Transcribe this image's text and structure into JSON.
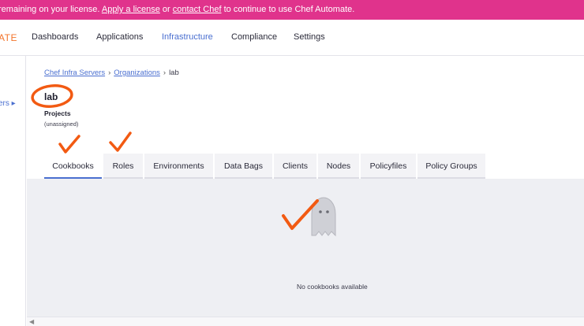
{
  "banner": {
    "text_before": " remaining on your license. ",
    "apply_link": "Apply a license",
    "text_or": " or ",
    "contact_link": "contact Chef",
    "text_after": " to continue to use Chef Automate."
  },
  "topnav": {
    "logo": "ATE",
    "items": [
      {
        "label": "Dashboards"
      },
      {
        "label": "Applications"
      },
      {
        "label": "Infrastructure"
      },
      {
        "label": "Compliance"
      },
      {
        "label": "Settings"
      }
    ],
    "active": "Infrastructure"
  },
  "sidebar": {
    "item_label": "ers ▸"
  },
  "breadcrumb": {
    "items": [
      "Chef Infra Servers",
      "Organizations",
      "lab"
    ],
    "separator": "›"
  },
  "page": {
    "title": "lab",
    "projects_label": "Projects",
    "projects_value": "(unassigned)"
  },
  "tabs": [
    {
      "label": "Cookbooks"
    },
    {
      "label": "Roles"
    },
    {
      "label": "Environments"
    },
    {
      "label": "Data Bags"
    },
    {
      "label": "Clients"
    },
    {
      "label": "Nodes"
    },
    {
      "label": "Policyfiles"
    },
    {
      "label": "Policy Groups"
    }
  ],
  "active_tab": "Cookbooks",
  "empty_state": {
    "icon": "ghost-icon",
    "message": "No cookbooks available"
  },
  "colors": {
    "banner": "#e0338c",
    "accent": "#4a6fd0",
    "logo": "#f3742b",
    "annotation": "#f25a12"
  }
}
